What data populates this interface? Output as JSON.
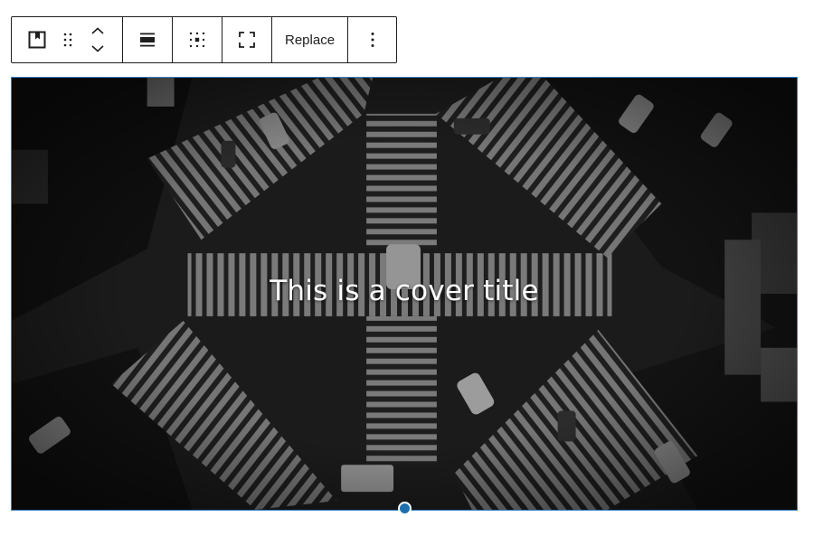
{
  "toolbar": {
    "buttons": [
      {
        "name": "block-type-cover",
        "icon": "cover-block-icon"
      },
      {
        "name": "drag",
        "icon": "drag-handle-icon"
      },
      {
        "name": "move-up",
        "icon": "chevron-up-icon"
      },
      {
        "name": "move-down",
        "icon": "chevron-down-icon"
      },
      {
        "name": "align",
        "icon": "align-wide-icon"
      },
      {
        "name": "content-position",
        "icon": "position-grid-icon"
      },
      {
        "name": "full-height",
        "icon": "fullscreen-icon"
      },
      {
        "name": "options",
        "icon": "more-vertical-icon"
      }
    ],
    "replace_label": "Replace"
  },
  "cover": {
    "title": "This is a cover title",
    "overlay_color": "#000000",
    "border_color": "#3582c4",
    "handle_color": "#1e6fae"
  }
}
